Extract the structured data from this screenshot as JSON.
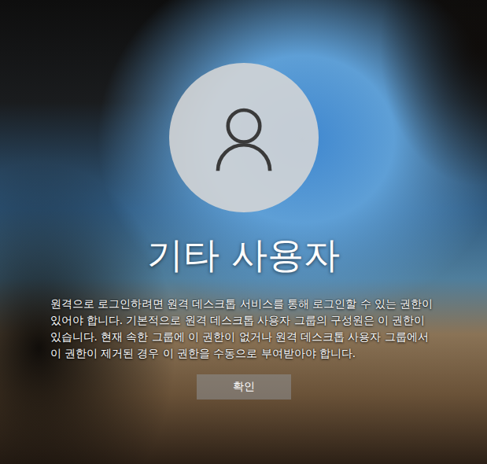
{
  "user": {
    "name": "기타 사용자"
  },
  "message": "원격으로 로그인하려면 원격 데스크톱 서비스를 통해 로그인할 수 있는 권한이 있어야 합니다. 기본적으로 원격 데스크톱 사용자 그룹의 구성원은 이 권한이 있습니다. 현재 속한 그룹에 이 권한이 없거나 원격 데스크톱 사용자 그룹에서 이 권한이 제거된 경우 이 권한을 수동으로 부여받아야 합니다.",
  "buttons": [
    "확인"
  ]
}
